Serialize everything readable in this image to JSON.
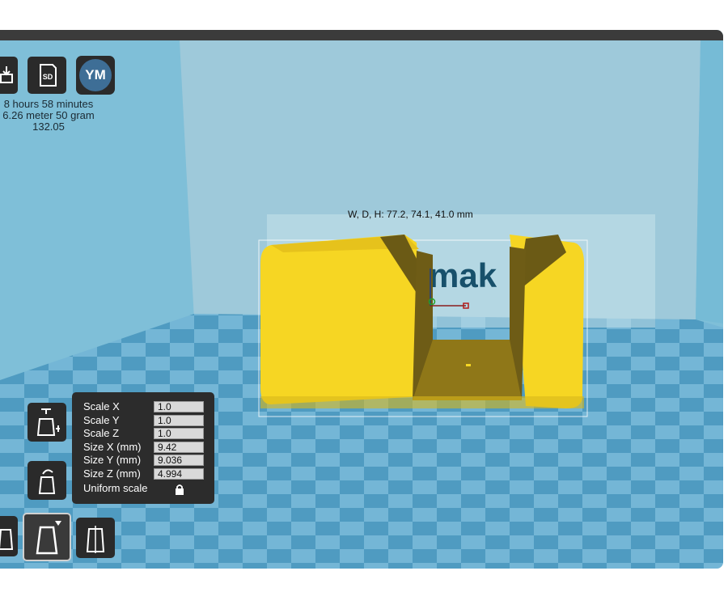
{
  "toolbar": {
    "sd_label": "SD",
    "ym_label": "YM"
  },
  "print_stats": {
    "time": "8 hours 58 minutes",
    "material": "6.26 meter 50 gram",
    "cost": "132.05"
  },
  "model": {
    "dimensions": "W, D, H: 77.2, 74.1, 41.0 mm",
    "backdrop_text": "mak",
    "color": "#f6d623"
  },
  "scale_panel": {
    "rows": [
      {
        "label": "Scale X",
        "value": "1.0"
      },
      {
        "label": "Scale Y",
        "value": "1.0"
      },
      {
        "label": "Scale Z",
        "value": "1.0"
      },
      {
        "label": "Size X (mm)",
        "value": "9.42"
      },
      {
        "label": "Size Y (mm)",
        "value": "9.036"
      },
      {
        "label": "Size Z (mm)",
        "value": "4.994"
      }
    ],
    "uniform_label": "Uniform scale"
  },
  "colors": {
    "floor_dark": "#4f9bc1",
    "floor_light": "#74b6d6",
    "wall": "#9ec9da",
    "panel": "#2c2c2c",
    "accent": "#3e6e96"
  }
}
